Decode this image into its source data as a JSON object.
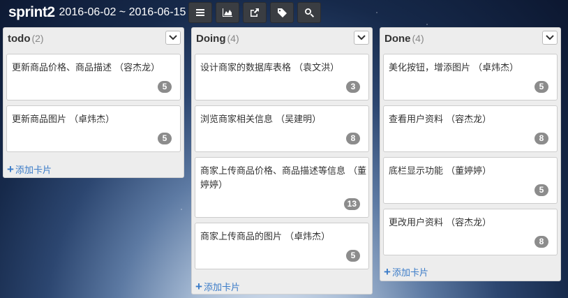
{
  "header": {
    "title": "sprint2",
    "date_range": "2016-06-02 ~ 2016-06-15",
    "buttons": [
      {
        "icon": "menu-icon"
      },
      {
        "icon": "area-chart-icon"
      },
      {
        "icon": "share-icon"
      },
      {
        "icon": "tag-icon"
      },
      {
        "icon": "search-icon"
      }
    ]
  },
  "lanes": [
    {
      "title": "todo",
      "count": "(2)",
      "add_label": "添加卡片",
      "cards": [
        {
          "text": "更新商品价格、商品描述 （容杰龙）",
          "points": "5"
        },
        {
          "text": "更新商品图片 （卓炜杰）",
          "points": "5"
        }
      ]
    },
    {
      "title": "Doing",
      "count": "(4)",
      "add_label": "添加卡片",
      "cards": [
        {
          "text": "设计商家的数据库表格 （袁文洪）",
          "points": "3"
        },
        {
          "text": "浏览商家相关信息 （吴建明）",
          "points": "8"
        },
        {
          "text": "商家上传商品价格、商品描述等信息 （董婷婷）",
          "points": "13"
        },
        {
          "text": "商家上传商品的图片 （卓炜杰）",
          "points": "5"
        }
      ]
    },
    {
      "title": "Done",
      "count": "(4)",
      "add_label": "添加卡片",
      "cards": [
        {
          "text": "美化按钮，增添图片 （卓炜杰）",
          "points": "5"
        },
        {
          "text": "查看用户资料 （容杰龙）",
          "points": "8"
        },
        {
          "text": "底栏显示功能 （董婷婷）",
          "points": "5"
        },
        {
          "text": "更改用户资料 （容杰龙）",
          "points": "8"
        }
      ]
    }
  ]
}
